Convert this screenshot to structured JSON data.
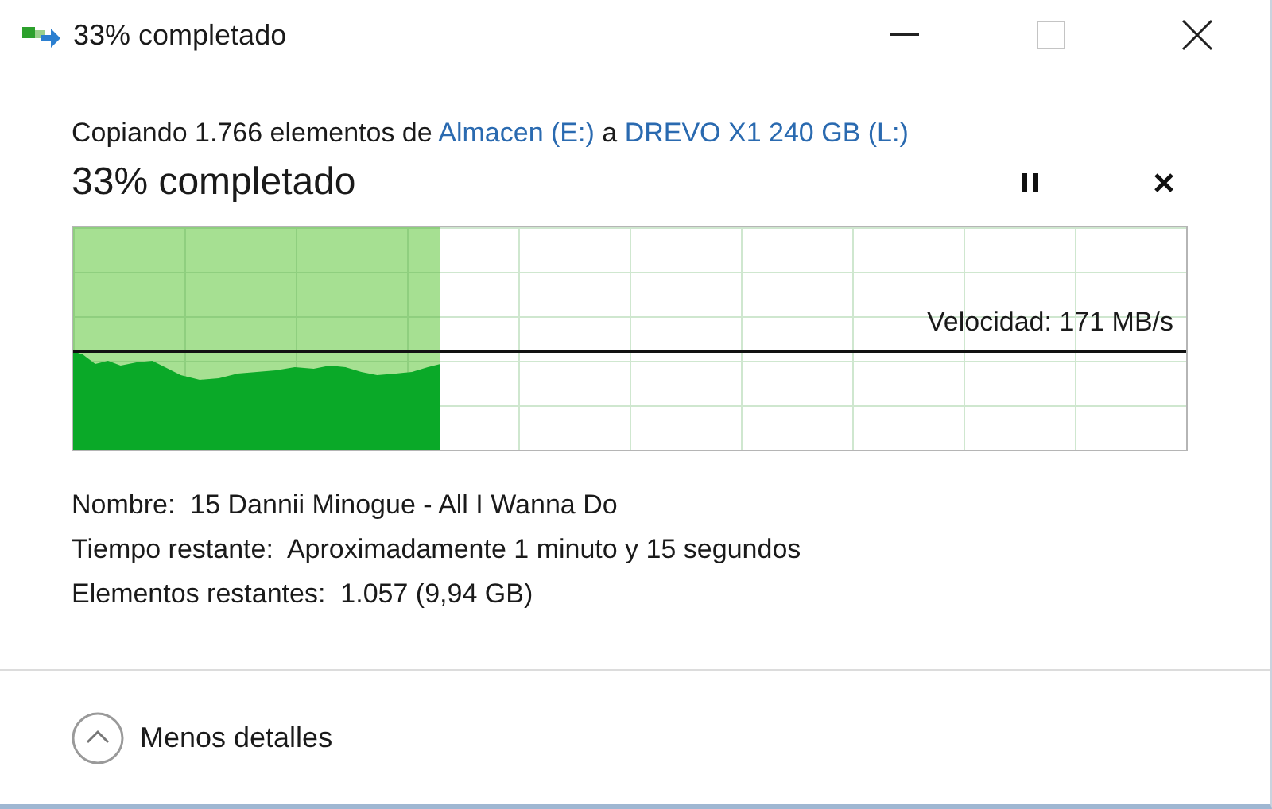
{
  "window": {
    "title": "33% completado"
  },
  "summary": {
    "prefix": "Copiando 1.766 elementos de",
    "source": "Almacen (E:)",
    "connector": "a",
    "destination": "DREVO X1 240 GB (L:)"
  },
  "progress": {
    "heading": "33% completado",
    "level": 0.33,
    "speed": "Velocidad: 171 MB/s"
  },
  "details": [
    {
      "label": "Nombre:",
      "value": "15 Dannii Minogue - All I Wanna Do"
    },
    {
      "label": "Tiempo restante:",
      "value": "Aproximadamente 1 minuto y 15 segundos"
    },
    {
      "label": "Elementos restantes:",
      "value": "1.057 (9,94 GB)"
    }
  ],
  "footer": {
    "toggle": "Menos detalles",
    "expanded": true
  }
}
